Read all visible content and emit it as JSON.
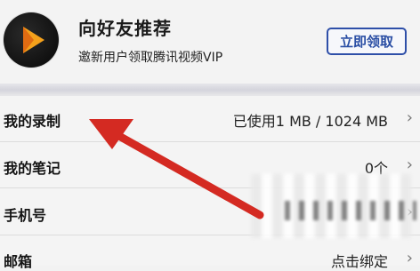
{
  "promo": {
    "title": "向好友推荐",
    "subtitle": "邀新用户领取腾讯视频VIP",
    "button": "立即领取"
  },
  "rows": [
    {
      "label": "我的录制",
      "value": "已使用1 MB / 1024 MB"
    },
    {
      "label": "我的笔记",
      "value": "0个"
    },
    {
      "label": "手机号",
      "value": ""
    },
    {
      "label": "邮箱",
      "value": "点击绑定"
    }
  ],
  "colors": {
    "accent": "#2a4ea4",
    "link": "#2a63c9",
    "arrow": "#d42a22"
  },
  "icons": {
    "avatar": "tencent-video-logo",
    "chevron": "chevron-right-icon",
    "annotation": "red-arrow"
  }
}
